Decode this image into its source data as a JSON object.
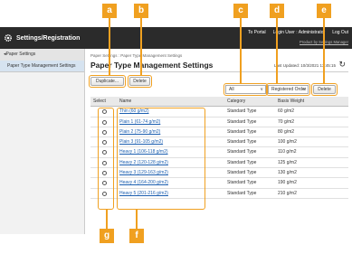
{
  "header": {
    "title": "Settings/Registration",
    "links": [
      "To Portal",
      "Login User : Administrator",
      "Log Out"
    ],
    "help": "Product by Settings Manager"
  },
  "sidebar": {
    "items": [
      {
        "label": "◂Paper Settings"
      },
      {
        "label": "Paper Type Management Settings"
      }
    ]
  },
  "main": {
    "breadcrumb": "Paper Settings : Paper Type Management Settings",
    "title": "Paper Type Management Settings",
    "last_updated": "Last Updated: 10/3/2021 13:45:15",
    "buttons": {
      "duplicate": "Duplicate...",
      "delete": "Delete",
      "delete2": "Delete"
    },
    "filters": {
      "category": "All",
      "order": "Registered Order"
    },
    "columns": {
      "select": "Select",
      "name": "Name",
      "category": "Category",
      "weight": "Basis Weight"
    },
    "rows": [
      {
        "name": "Thin (60 g/m2)",
        "category": "Standard Type",
        "weight": "60 g/m2"
      },
      {
        "name": "Plain 1 (61-74 g/m2)",
        "category": "Standard Type",
        "weight": "70 g/m2"
      },
      {
        "name": "Plain 2 (75-90 g/m2)",
        "category": "Standard Type",
        "weight": "80 g/m2"
      },
      {
        "name": "Plain 3 (91-105 g/m2)",
        "category": "Standard Type",
        "weight": "100 g/m2"
      },
      {
        "name": "Heavy 1 (106-118 g/m2)",
        "category": "Standard Type",
        "weight": "110 g/m2"
      },
      {
        "name": "Heavy 2 (120-128 g/m2)",
        "category": "Standard Type",
        "weight": "125 g/m2"
      },
      {
        "name": "Heavy 3 (129-163 g/m2)",
        "category": "Standard Type",
        "weight": "130 g/m2"
      },
      {
        "name": "Heavy 4 (164-200 g/m2)",
        "category": "Standard Type",
        "weight": "190 g/m2"
      },
      {
        "name": "Heavy 5 (201-216 g/m2)",
        "category": "Standard Type",
        "weight": "210 g/m2"
      }
    ]
  },
  "annotations": {
    "color": "#f0a020",
    "a": "a",
    "b": "b",
    "c": "c",
    "d": "d",
    "e": "e",
    "f": "f",
    "g": "g"
  }
}
